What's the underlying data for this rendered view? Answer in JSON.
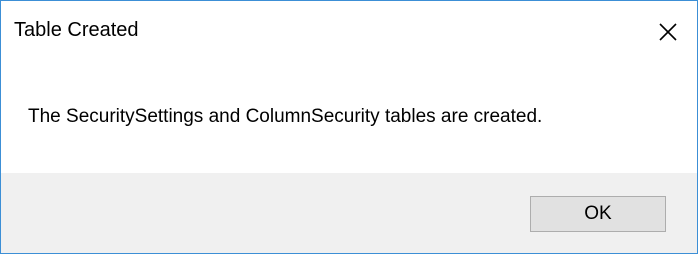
{
  "dialog": {
    "title": "Table Created",
    "message": "The SecuritySettings and ColumnSecurity tables are created.",
    "ok_label": "OK",
    "close_icon": "close-icon"
  },
  "colors": {
    "window_border": "#3c8fd6",
    "footer_background": "#f0f0f0",
    "button_background": "#e1e1e1",
    "button_border": "#adadad"
  }
}
